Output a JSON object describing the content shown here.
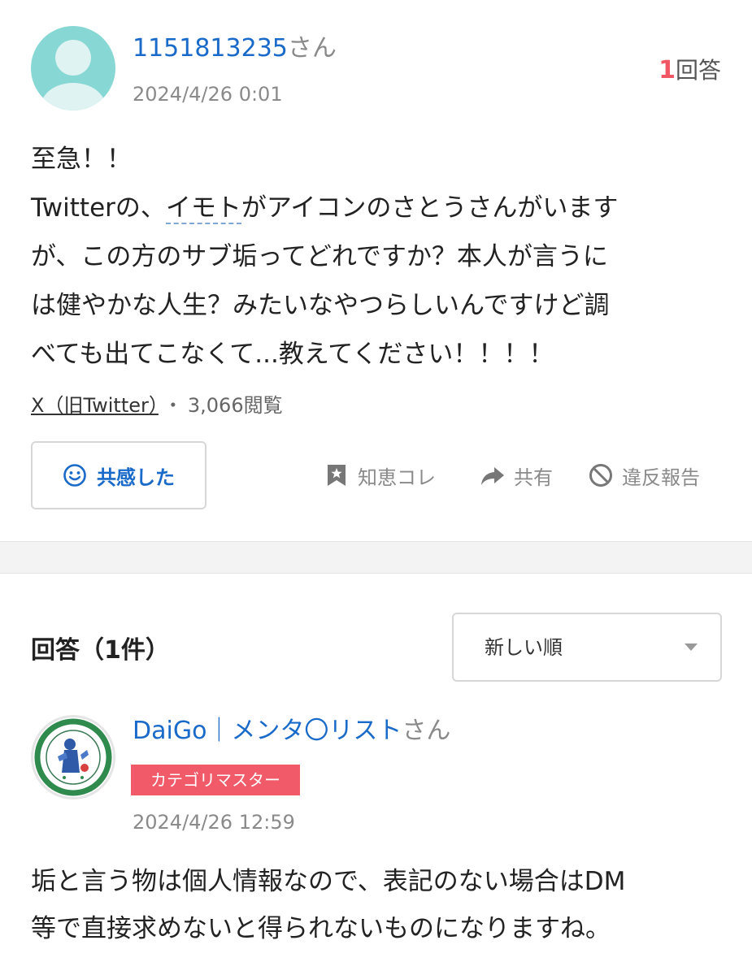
{
  "question": {
    "username": "1151813235",
    "username_suffix": "さん",
    "date": "2024/4/26 0:01",
    "answer_count_number": "1",
    "answer_count_suffix": "回答",
    "body_lines": [
      "至急！！",
      "Twitterの、",
      "イモト",
      "がアイコンのさとうさんがいます",
      "が、この方のサブ垢ってどれですか？本人が言うに",
      "は健やかな人生？みたいなやつらしいんですけど調",
      "べても出てこなくて...教えてください！！！！"
    ],
    "category": "X（旧Twitter）",
    "separator": "・",
    "views": "3,066閲覧",
    "empathy_button": "共感した",
    "actions": {
      "chie": "知恵コレ",
      "share": "共有",
      "report": "違反報告"
    }
  },
  "answers_section": {
    "title": "回答（1件）",
    "sort_selected": "新しい順"
  },
  "answer": {
    "username": "DaiGo｜メンタ〇リスト",
    "username_suffix": "さん",
    "badge": "カテゴリマスター",
    "date": "2024/4/26 12:59",
    "body_lines": [
      "垢と言う物は個人情報なので、表記のない場合はDM",
      "等で直接求めないと得られないものになりますね。"
    ]
  },
  "colors": {
    "link_blue": "#1a6ac9",
    "accent_red": "#f05664",
    "badge_red": "#f15b69",
    "muted_gray": "#8a8a8a",
    "avatar_teal": "#87d7d4"
  },
  "icons": {
    "empathy": "smile-icon",
    "chie": "bookmark-star-icon",
    "share": "share-arrow-icon",
    "report": "prohibited-icon",
    "sort": "chevron-down-icon"
  }
}
